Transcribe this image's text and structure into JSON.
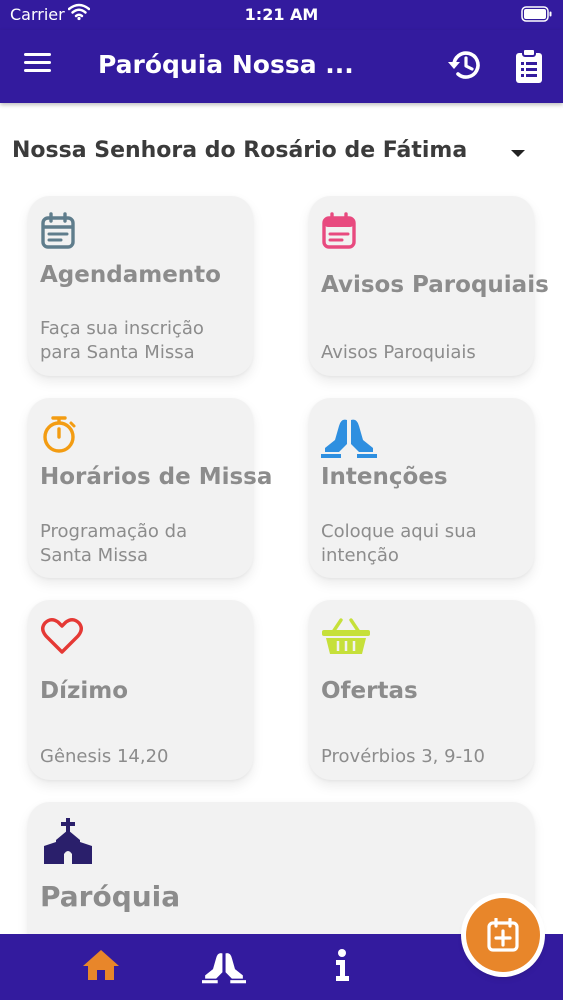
{
  "status_bar": {
    "carrier": "Carrier",
    "time": "1:21 AM"
  },
  "app_bar": {
    "title": "Paróquia Nossa ..."
  },
  "parish_selector": {
    "selected": "Nossa Senhora do Rosário de Fátima"
  },
  "cards": [
    {
      "title": "Agendamento",
      "subtitle": "Faça sua inscrição para Santa Missa",
      "icon": "calendar-icon",
      "color": "#5f7d8c"
    },
    {
      "title": "Avisos Paroquiais",
      "subtitle": "Avisos Paroquiais",
      "icon": "calendar-notes-icon",
      "color": "#e84a7f"
    },
    {
      "title": "Horários de Missa",
      "subtitle": "Programação da Santa Missa",
      "icon": "stopwatch-icon",
      "color": "#f39c12"
    },
    {
      "title": "Intenções",
      "subtitle": "Coloque aqui sua intenção",
      "icon": "praying-hands-icon",
      "color": "#2e8fe0"
    },
    {
      "title": "Dízimo",
      "subtitle": "Gênesis 14,20",
      "icon": "heart-icon",
      "color": "#e53935"
    },
    {
      "title": "Ofertas",
      "subtitle": "Provérbios 3, 9-10",
      "icon": "basket-icon",
      "color": "#c6e03a"
    },
    {
      "title": "Paróquia",
      "subtitle": "",
      "icon": "church-icon",
      "color": "#2a1f6b"
    }
  ],
  "bottom_nav": [
    {
      "icon": "home-icon",
      "color": "#e8862a",
      "active": true
    },
    {
      "icon": "praying-hands-icon",
      "color": "#ffffff",
      "active": false
    },
    {
      "icon": "info-icon",
      "color": "#ffffff",
      "active": false
    }
  ],
  "fab": {
    "icon": "calendar-plus-icon",
    "color": "#e8862a"
  },
  "colors": {
    "primary": "#331b9e",
    "card_bg": "#f2f2f2",
    "text_muted": "#8c8c8c"
  }
}
